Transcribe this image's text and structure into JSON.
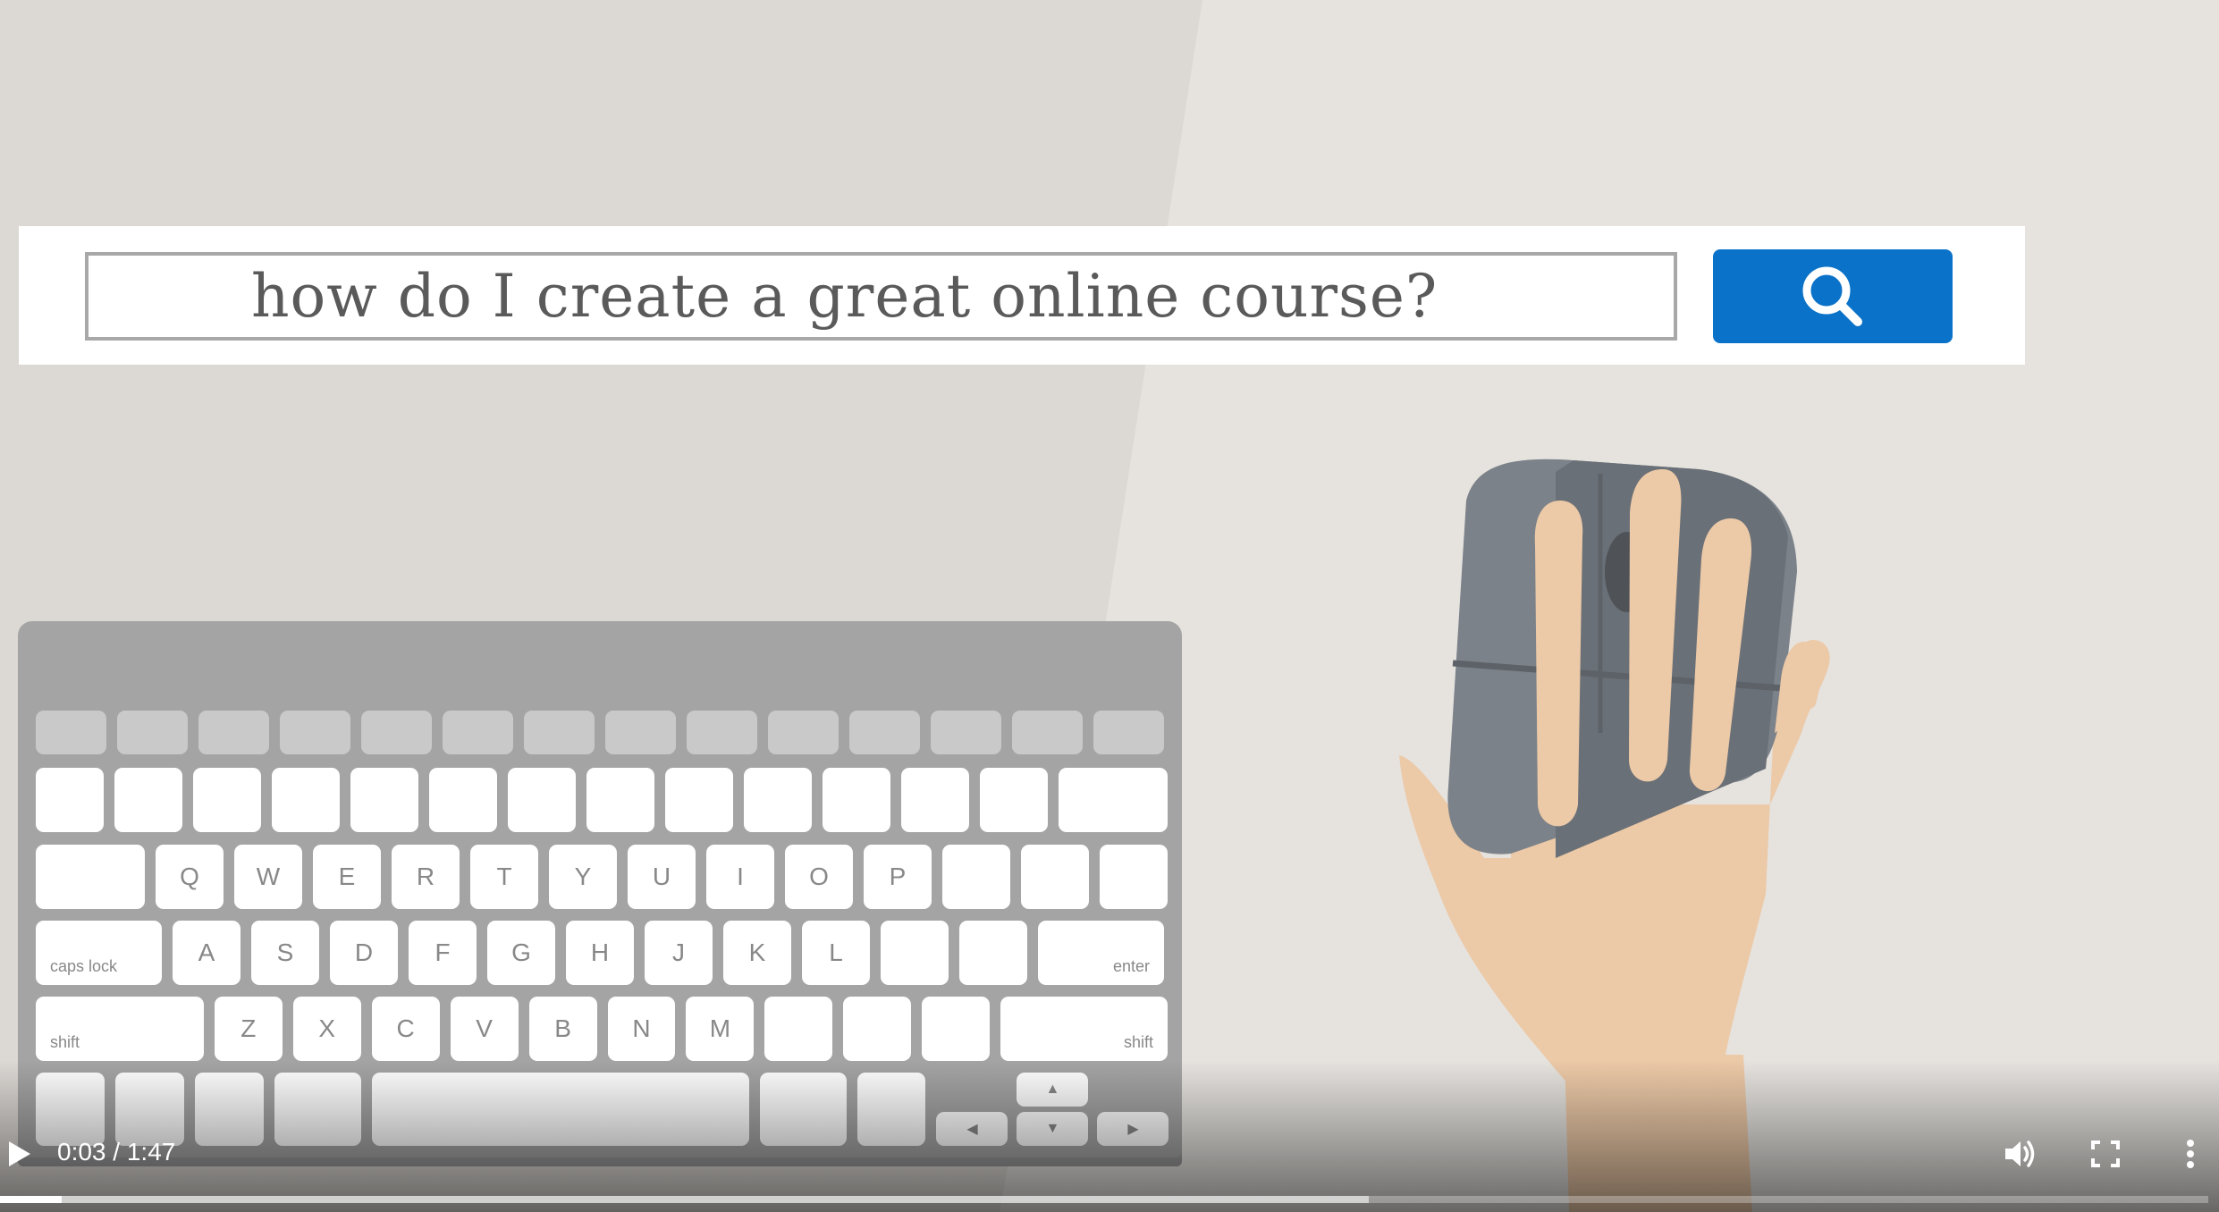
{
  "search": {
    "query": "how do I create a great online course?",
    "button_icon": "search-icon",
    "button_color": "#0a72c8"
  },
  "keyboard": {
    "row_q": [
      "Q",
      "W",
      "E",
      "R",
      "T",
      "Y",
      "U",
      "I",
      "O",
      "P"
    ],
    "row_a": [
      "A",
      "S",
      "D",
      "F",
      "G",
      "H",
      "J",
      "K",
      "L"
    ],
    "row_z": [
      "Z",
      "X",
      "C",
      "V",
      "B",
      "N",
      "M"
    ],
    "caps_lock": "caps lock",
    "enter": "enter",
    "shift_left": "shift",
    "shift_right": "shift",
    "arrows": {
      "up": "▲",
      "left": "◀",
      "down": "▼",
      "right": "▶"
    }
  },
  "player": {
    "current_time": "0:03",
    "duration": "1:47",
    "time_separator": "/",
    "progress_fraction": 0.028,
    "buffered_fraction": 0.62,
    "icons": [
      "play-icon",
      "volume-icon",
      "fullscreen-icon",
      "more-options-icon"
    ]
  }
}
